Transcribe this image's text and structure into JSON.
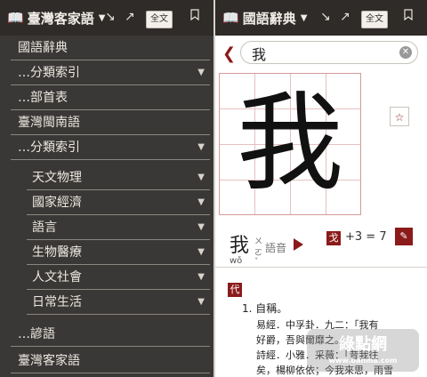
{
  "left": {
    "title": "臺灣客家語",
    "full_text_button": "全文",
    "menu": [
      {
        "label": "國語辭典",
        "arrow": false,
        "indent": 0
      },
      {
        "label": "…分類索引",
        "arrow": true,
        "indent": 0
      },
      {
        "label": "…部首表",
        "arrow": false,
        "indent": 0
      },
      {
        "label": "臺灣閩南語",
        "arrow": false,
        "indent": 0
      },
      {
        "label": "…分類索引",
        "arrow": true,
        "indent": 0
      },
      {
        "label": "天文物理",
        "arrow": true,
        "indent": 1
      },
      {
        "label": "國家經濟",
        "arrow": true,
        "indent": 1
      },
      {
        "label": "語言",
        "arrow": true,
        "indent": 1
      },
      {
        "label": "生物醫療",
        "arrow": true,
        "indent": 1
      },
      {
        "label": "人文社會",
        "arrow": true,
        "indent": 1
      },
      {
        "label": "日常生活",
        "arrow": true,
        "indent": 1
      },
      {
        "label": "…諺語",
        "arrow": false,
        "indent": 0
      },
      {
        "label": "臺灣客家語",
        "arrow": false,
        "indent": 0
      }
    ]
  },
  "right": {
    "title": "國語辭典",
    "full_text_button": "全文",
    "search_value": "我",
    "glyph": "我",
    "entry": {
      "character": "我",
      "pinyin": "wǒ",
      "zhuyin": "ㄨㄛˇ",
      "audio_label": "語音",
      "radical": "戈",
      "stroke_text": "+3 = 7",
      "pos": "代",
      "definition": "1. 自稱。",
      "examples": [
        "易經．中孚卦．九二：「我有",
        "好爵，吾與爾靡之。」",
        "詩經．小雅．采薇：「昔我往",
        "矣，楊柳依依；今我來思，雨雪"
      ]
    }
  },
  "watermark": {
    "text": "綠點網",
    "sub": "www.banma.com"
  },
  "colors": {
    "accent": "#8b1a1a",
    "topbar": "#2e2b29",
    "left_bg": "#3a3836"
  }
}
